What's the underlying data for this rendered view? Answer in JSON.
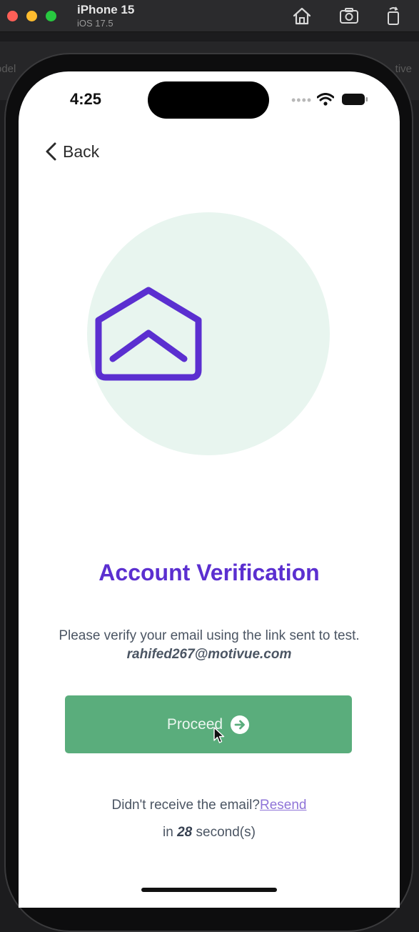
{
  "window": {
    "device_name": "iPhone 15",
    "os_version": "iOS 17.5",
    "bg_left_text": "odel",
    "bg_right_text": "tive"
  },
  "status_bar": {
    "time": "4:25",
    "dots": "••••"
  },
  "nav": {
    "back_label": "Back"
  },
  "content": {
    "title": "Account Verification",
    "description_prefix": "Please verify your email using the link sent to test. ",
    "email": "rahifed267@motivue.com",
    "proceed_label": "Proceed",
    "resend_prompt": "Didn't receive the email?",
    "resend_link": "Resend",
    "timer_prefix": "in ",
    "timer_count": "28",
    "timer_suffix": " second(s)"
  },
  "colors": {
    "accent_purple": "#5b2fd0",
    "proceed_green": "#5aad7c",
    "illustration_bg": "#e8f5ef",
    "link_purple": "#8f74d8"
  },
  "icons": {
    "home": "home-icon",
    "screenshot": "screenshot-icon",
    "rotate": "rotate-icon",
    "wifi": "wifi-icon",
    "battery": "battery-icon",
    "back": "chevron-left-icon",
    "envelope": "envelope-open-icon",
    "arrow": "arrow-right-circle-icon",
    "cursor": "mouse-cursor-icon"
  }
}
